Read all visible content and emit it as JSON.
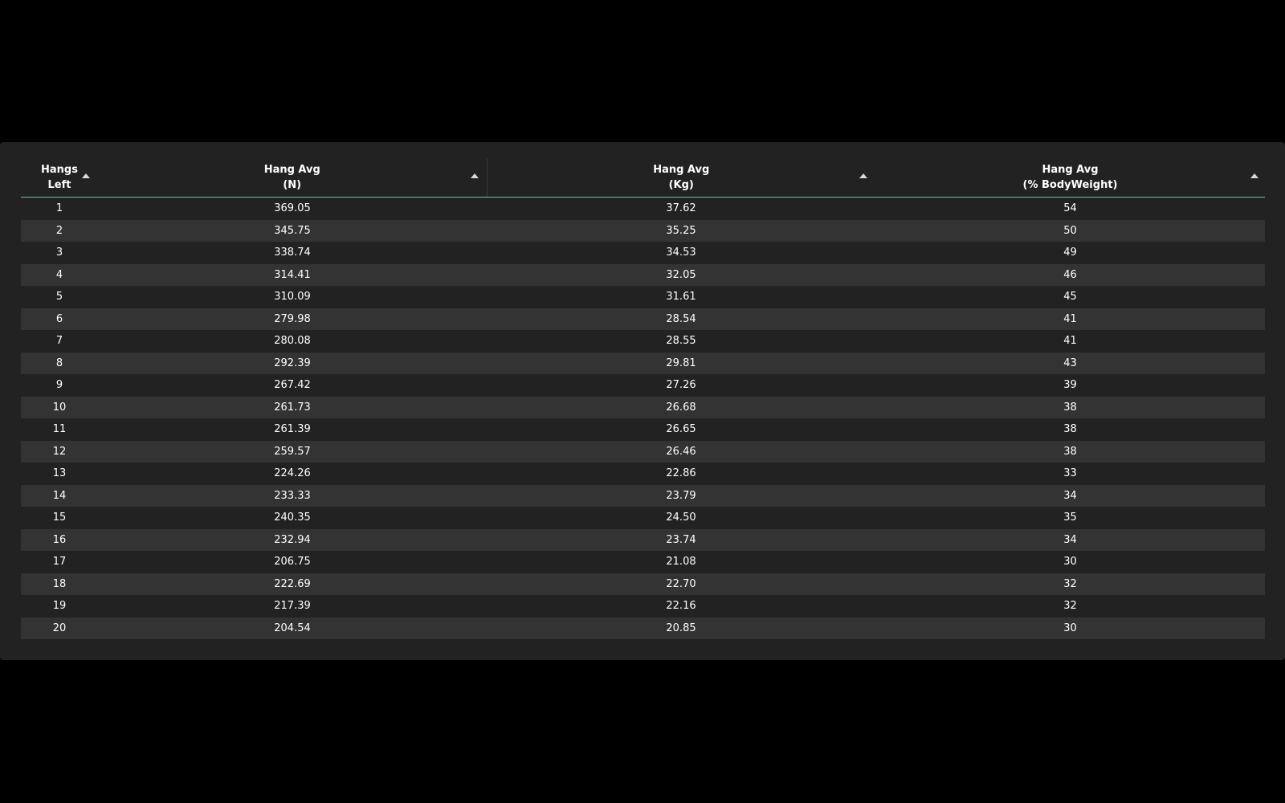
{
  "table": {
    "columns": [
      {
        "line1": "Hangs",
        "line2": "Left"
      },
      {
        "line1": "Hang Avg",
        "line2": "(N)"
      },
      {
        "line1": "Hang Avg",
        "line2": "(Kg)"
      },
      {
        "line1": "Hang Avg",
        "line2": "(% BodyWeight)"
      }
    ],
    "sort_icon": "triangle-up-icon",
    "rows": [
      [
        "1",
        "369.05",
        "37.62",
        "54"
      ],
      [
        "2",
        "345.75",
        "35.25",
        "50"
      ],
      [
        "3",
        "338.74",
        "34.53",
        "49"
      ],
      [
        "4",
        "314.41",
        "32.05",
        "46"
      ],
      [
        "5",
        "310.09",
        "31.61",
        "45"
      ],
      [
        "6",
        "279.98",
        "28.54",
        "41"
      ],
      [
        "7",
        "280.08",
        "28.55",
        "41"
      ],
      [
        "8",
        "292.39",
        "29.81",
        "43"
      ],
      [
        "9",
        "267.42",
        "27.26",
        "39"
      ],
      [
        "10",
        "261.73",
        "26.68",
        "38"
      ],
      [
        "11",
        "261.39",
        "26.65",
        "38"
      ],
      [
        "12",
        "259.57",
        "26.46",
        "38"
      ],
      [
        "13",
        "224.26",
        "22.86",
        "33"
      ],
      [
        "14",
        "233.33",
        "23.79",
        "34"
      ],
      [
        "15",
        "240.35",
        "24.50",
        "35"
      ],
      [
        "16",
        "232.94",
        "23.74",
        "34"
      ],
      [
        "17",
        "206.75",
        "21.08",
        "30"
      ],
      [
        "18",
        "222.69",
        "22.70",
        "32"
      ],
      [
        "19",
        "217.39",
        "22.16",
        "32"
      ],
      [
        "20",
        "204.54",
        "20.85",
        "30"
      ]
    ]
  },
  "colors": {
    "page_background": "#000000",
    "panel_background": "#222222",
    "row_alt_background": "#333333",
    "header_underline": "#6fbfa4",
    "text": "#ffffff"
  }
}
